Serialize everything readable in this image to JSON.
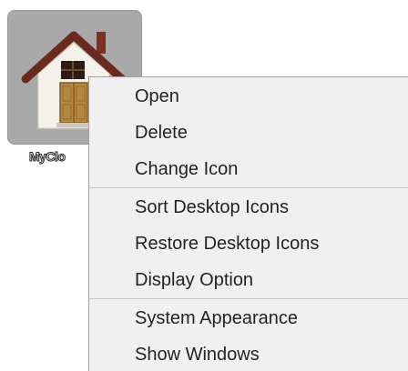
{
  "desktop_icon": {
    "label": "MyClo",
    "icon": "house-icon"
  },
  "context_menu": {
    "groups": [
      {
        "items": [
          {
            "label": "Open"
          },
          {
            "label": "Delete"
          },
          {
            "label": "Change Icon"
          }
        ]
      },
      {
        "items": [
          {
            "label": "Sort Desktop Icons"
          },
          {
            "label": "Restore Desktop Icons"
          },
          {
            "label": "Display Option"
          }
        ]
      },
      {
        "items": [
          {
            "label": "System Appearance"
          },
          {
            "label": "Show Windows"
          }
        ]
      }
    ]
  },
  "colors": {
    "icon_tile": "#a9a9a9",
    "menu_background": "#f0f0f0",
    "menu_border": "#a0a0a0",
    "roof": "#6b2a1f",
    "door": "#b8873f"
  }
}
